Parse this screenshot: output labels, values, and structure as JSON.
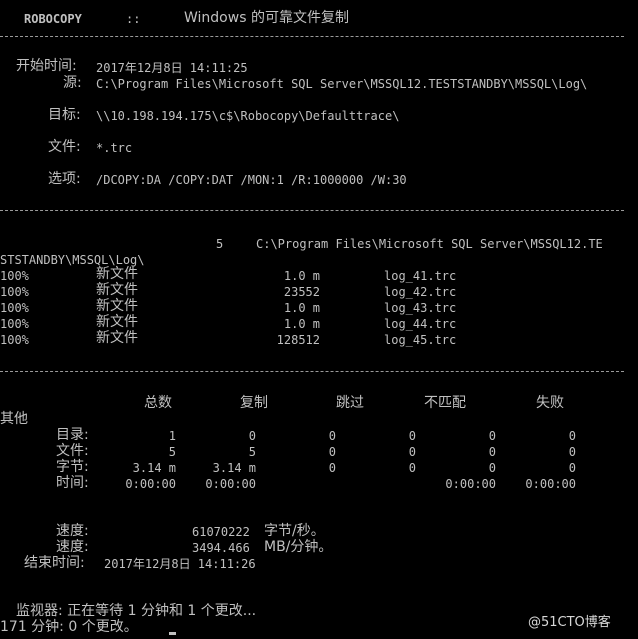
{
  "header": {
    "app": "ROBOCOPY",
    "sep": "::",
    "title": "Windows 的可靠文件复制"
  },
  "params": {
    "start_label": "开始时间:",
    "start_value": "2017年12月8日 14:11:25",
    "source_label": "源:",
    "source_value": "C:\\Program Files\\Microsoft SQL Server\\MSSQL12.TESTSTANDBY\\MSSQL\\Log\\",
    "dest_label": "目标:",
    "dest_value": "\\\\10.198.194.175\\c$\\Robocopy\\Defaulttrace\\",
    "files_label": "文件:",
    "files_value": "*.trc",
    "options_label": "选项:",
    "options_value": "/DCOPY:DA /COPY:DAT /MON:1 /R:1000000 /W:30"
  },
  "dir": {
    "count": "5",
    "path_part1": "C:\\Program Files\\Microsoft SQL Server\\MSSQL12.TE",
    "path_part2": "STSTANDBY\\MSSQL\\Log\\"
  },
  "files": [
    {
      "pct": "100%",
      "status": "新文件",
      "size": "1.0 m",
      "name": "log_41.trc"
    },
    {
      "pct": "100%",
      "status": "新文件",
      "size": "23552",
      "name": "log_42.trc"
    },
    {
      "pct": "100%",
      "status": "新文件",
      "size": "1.0 m",
      "name": "log_43.trc"
    },
    {
      "pct": "100%",
      "status": "新文件",
      "size": "1.0 m",
      "name": "log_44.trc"
    },
    {
      "pct": "100%",
      "status": "新文件",
      "size": "128512",
      "name": "log_45.trc"
    }
  ],
  "summary": {
    "headers": [
      "总数",
      "复制",
      "跳过",
      "不匹配",
      "失败"
    ],
    "other_header": "其他",
    "rows": [
      {
        "label": "目录:",
        "values": [
          "1",
          "0",
          "0",
          "0",
          "0",
          "0"
        ]
      },
      {
        "label": "文件:",
        "values": [
          "5",
          "5",
          "0",
          "0",
          "0",
          "0"
        ]
      },
      {
        "label": "字节:",
        "values": [
          "3.14 m",
          "3.14 m",
          "0",
          "0",
          "0",
          "0"
        ]
      },
      {
        "label": "时间:",
        "values": [
          "0:00:00",
          "0:00:00",
          "",
          "",
          "0:00:00",
          "0:00:00"
        ]
      }
    ]
  },
  "speed": {
    "label1": "速度:",
    "value1": "61070222",
    "unit1": "字节/秒。",
    "label2": "速度:",
    "value2": "3494.466",
    "unit2": "MB/分钟。",
    "end_label": "结束时间:",
    "end_value": "2017年12月8日 14:11:26"
  },
  "monitor": {
    "line1": "监视器: 正在等待 1 分钟和 1 个更改...",
    "line2": "171 分钟: 0 个更改。"
  },
  "watermark": "@51CTO博客"
}
